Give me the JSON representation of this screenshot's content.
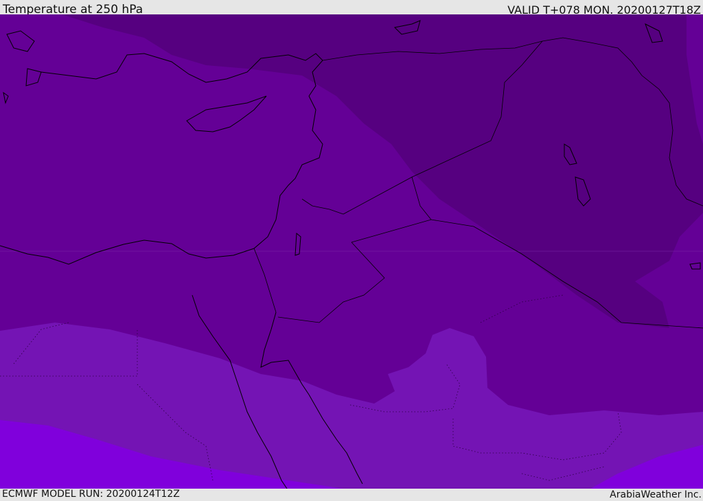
{
  "header": {
    "title": "Temperature at 250 hPa",
    "valid": "VALID T+078 MON. 20200127T18Z"
  },
  "footer": {
    "model_run": "ECMWF MODEL RUN: 20200124T12Z",
    "credit": "ArabiaWeather Inc."
  },
  "colors": {
    "coldest_band": "#560080",
    "cold_band": "#640096",
    "mid_band": "#7414B4",
    "warm_band": "#8000DC",
    "coastline": "#000000"
  }
}
